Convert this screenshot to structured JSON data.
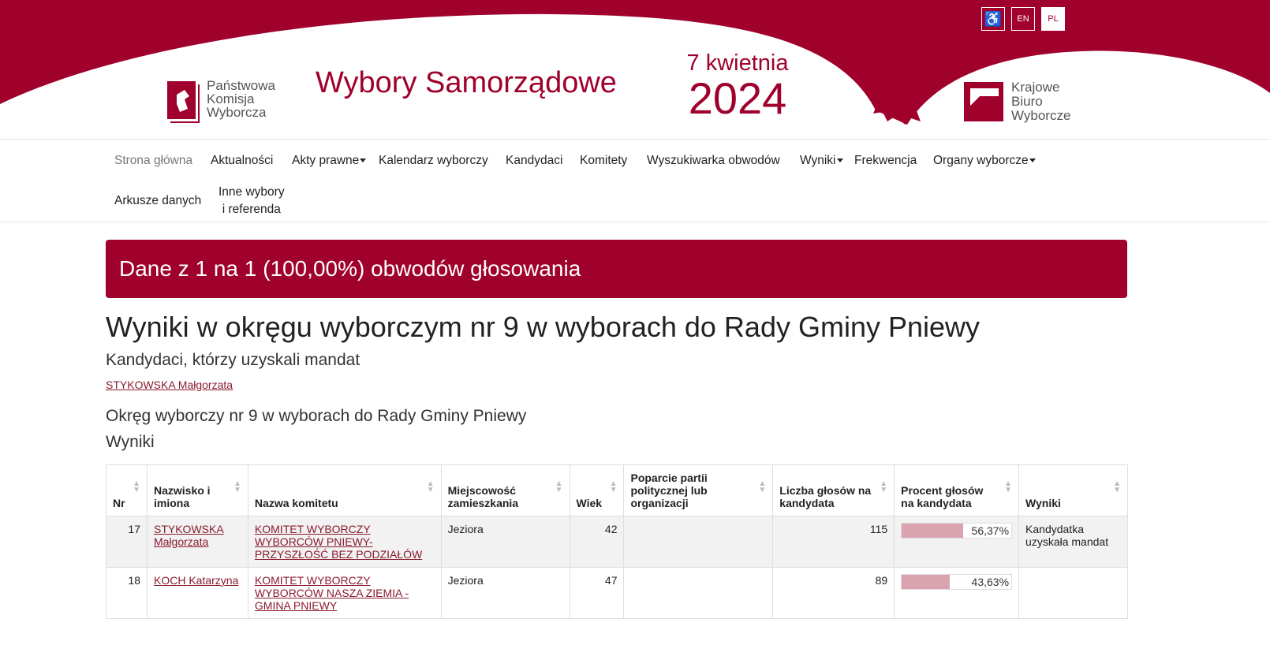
{
  "header": {
    "lang_buttons": [
      "EN",
      "PL"
    ],
    "pkw_name": [
      "Państwowa",
      "Komisja",
      "Wyborcza"
    ],
    "site_title": "Wybory Samorządowe",
    "date_day": "7 kwietnia",
    "date_year": "2024",
    "kbw_name": [
      "Krajowe",
      "Biuro",
      "Wyborcze"
    ],
    "brand_color": "#a0002c"
  },
  "nav": {
    "items": [
      "Strona główna",
      "Aktualności",
      "Akty prawne",
      "Kalendarz wyborczy",
      "Kandydaci",
      "Komitety",
      "Wyszukiwarka obwodów",
      "Wyniki",
      "Frekwencja",
      "Organy wyborcze",
      "Arkusze danych",
      "Inne wybory",
      "i referenda"
    ]
  },
  "banner": "Dane z 1 na 1 (100,00%) obwodów głosowania",
  "title": "Wyniki w okręgu wyborczym nr 9 w wyborach do Rady Gminy Pniewy",
  "subtitle": "Kandydaci, którzy uzyskali mandat",
  "elected_link": "STYKOWSKA Małgorzata",
  "district_heading": "Okręg wyborczy nr 9 w wyborach do Rady Gminy Pniewy",
  "results_heading": "Wyniki",
  "table": {
    "headers": [
      "Nr",
      "Nazwisko i imiona",
      "Nazwa komitetu",
      "Miejscowość zamieszkania",
      "Wiek",
      "Poparcie partii politycznej lub organizacji",
      "Liczba głosów na kandydata",
      "Procent głosów na kandydata",
      "Wyniki"
    ],
    "rows": [
      {
        "nr": "17",
        "name": "STYKOWSKA Małgorzata",
        "committee": "KOMITET WYBORCZY WYBORCÓW PNIEWY-PRZYSZŁOŚĆ BEZ PODZIAŁÓW",
        "town": "Jeziora",
        "age": "42",
        "support": "",
        "votes": "115",
        "percent": "56,37%",
        "percent_value": 56.37,
        "result": "Kandydatka uzyskała mandat"
      },
      {
        "nr": "18",
        "name": "KOCH Katarzyna",
        "committee": "KOMITET WYBORCZY WYBORCÓW NASZA ZIEMIA - GMINA PNIEWY",
        "town": "Jeziora",
        "age": "47",
        "support": "",
        "votes": "89",
        "percent": "43,63%",
        "percent_value": 43.63,
        "result": ""
      }
    ]
  }
}
